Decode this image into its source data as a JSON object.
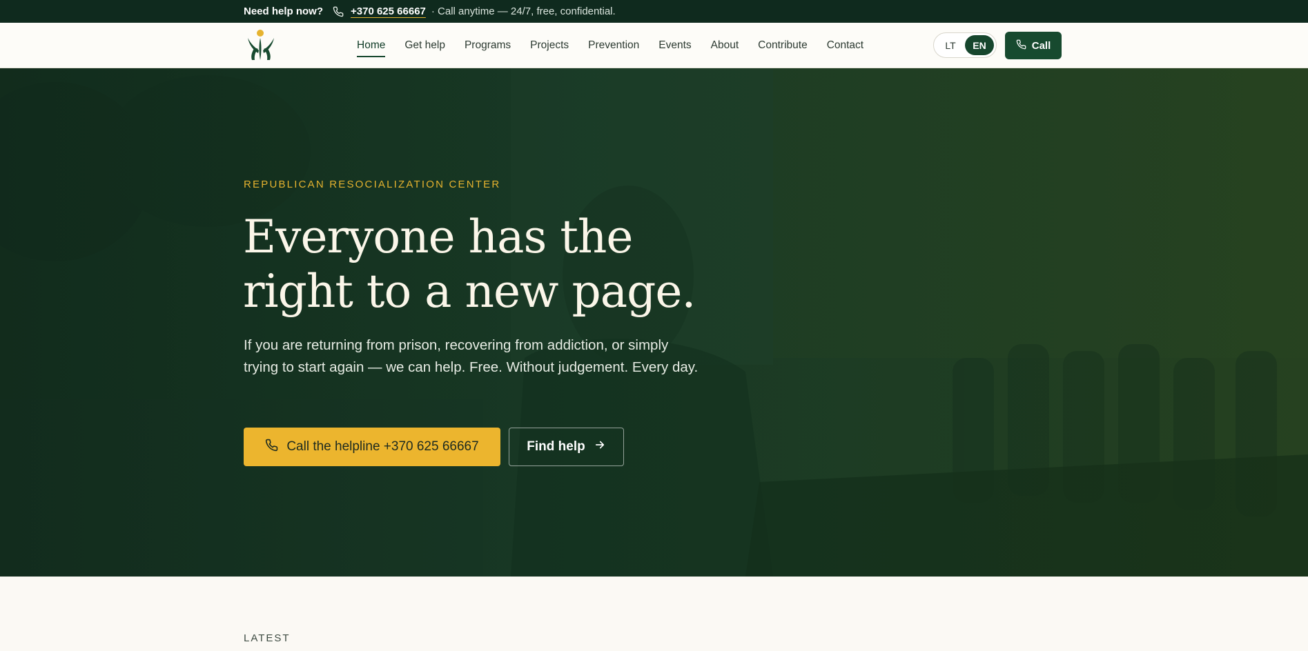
{
  "topbar": {
    "need_help": "Need help now?",
    "phone_icon": "phone-icon",
    "phone": "+370 625 66667",
    "rest": "· Call anytime — 24/7, free, confidential."
  },
  "header": {
    "logo_icon": "people-tree-logo",
    "nav": [
      {
        "label": "Home",
        "active": true
      },
      {
        "label": "Get help"
      },
      {
        "label": "Programs"
      },
      {
        "label": "Projects"
      },
      {
        "label": "Prevention"
      },
      {
        "label": "Events"
      },
      {
        "label": "About"
      },
      {
        "label": "Contribute"
      },
      {
        "label": "Contact"
      }
    ],
    "lang_lt": "LT",
    "lang_en": "EN",
    "call_label": "Call"
  },
  "hero": {
    "eyebrow": "REPUBLICAN RESOCIALIZATION CENTER",
    "headline_line1": "Everyone has the",
    "headline_line2": "right to a new page.",
    "lead": "If you are returning from prison, recovering from addiction, or simply trying to start again — we can help. Free. Without judgement. Every day.",
    "primary_cta": "Call the helpline +370 625 66667",
    "secondary_cta": "Find help"
  },
  "section": {
    "latest": "LATEST"
  },
  "colors": {
    "dark_green": "#0f2a1e",
    "brand_green": "#174a2f",
    "accent_yellow": "#ecb52e",
    "cream": "#fbf9f4"
  }
}
